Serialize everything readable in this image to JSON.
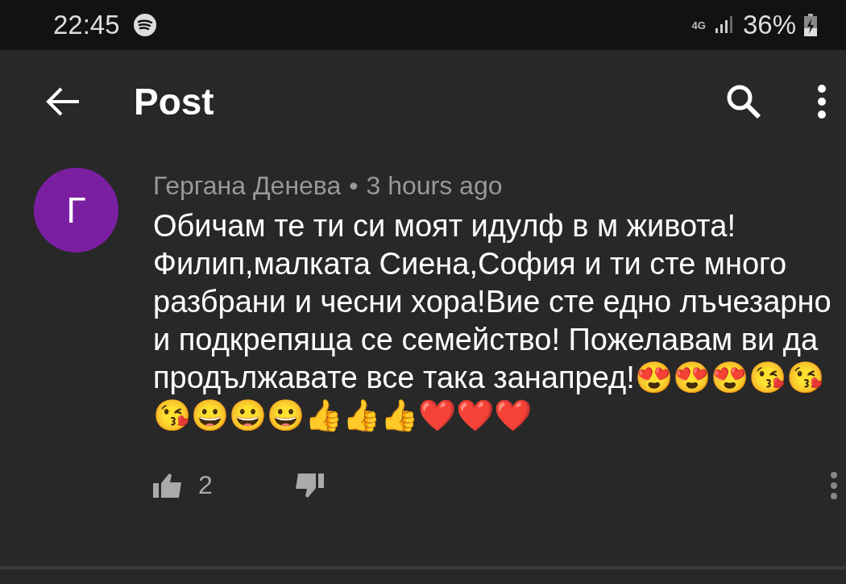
{
  "status_bar": {
    "time": "22:45",
    "network": "4G",
    "battery": "36%"
  },
  "app_bar": {
    "title": "Post"
  },
  "comment": {
    "avatar_letter": "Г",
    "author": "Гергана Денева",
    "separator": "•",
    "time": "3 hours ago",
    "text": "Обичам те ти си моят идулф в м живота! Филип,малката Сиена,София и ти сте много разбрани и чесни хора!Вие сте едно лъчезарно и подкрепяща се семейство! Пожелавам ви да продължавате все така занапред!😍😍😍😘😘😘😀😀😀👍👍👍❤️❤️❤️",
    "likes": "2"
  }
}
